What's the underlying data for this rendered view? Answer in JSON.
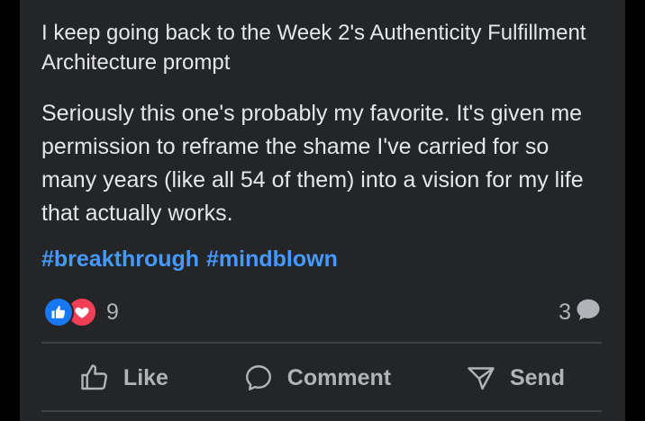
{
  "post": {
    "title": "I keep going back to the Week 2's Authenticity Fulfillment Architecture prompt",
    "body": "Seriously this one's probably my favorite. It's given me permission to reframe the shame I've carried for so many years (like all 54 of them) into a vision for my life that actually works.",
    "hashtags": [
      "#breakthrough",
      "#mindblown"
    ]
  },
  "stats": {
    "reaction_count": "9",
    "comment_count": "3",
    "reaction_icons": [
      "like-icon",
      "love-icon"
    ],
    "comment_icon": "comment-bubble-icon"
  },
  "actions": {
    "like_label": "Like",
    "comment_label": "Comment",
    "send_label": "Send"
  },
  "colors": {
    "background": "#242526",
    "text": "#e4e6eb",
    "muted_text": "#b0b3b8",
    "hashtag": "#4599ff",
    "like_blue": "#1877f2",
    "love_red": "#f33e58",
    "divider": "#3e4042"
  }
}
